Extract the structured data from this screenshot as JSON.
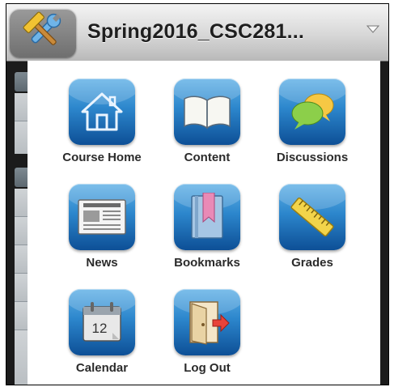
{
  "header": {
    "course_title": "Spring2016_CSC281...",
    "tools_icon": "tools-icon",
    "dropdown_icon": "chevron-down-icon"
  },
  "menu": {
    "items": [
      {
        "label": "Course Home",
        "icon": "home-icon"
      },
      {
        "label": "Content",
        "icon": "book-icon"
      },
      {
        "label": "Discussions",
        "icon": "speech-bubbles-icon"
      },
      {
        "label": "News",
        "icon": "newspaper-icon"
      },
      {
        "label": "Bookmarks",
        "icon": "bookmark-icon"
      },
      {
        "label": "Grades",
        "icon": "ruler-icon"
      },
      {
        "label": "Calendar",
        "icon": "calendar-icon"
      },
      {
        "label": "Log Out",
        "icon": "logout-door-icon"
      }
    ],
    "calendar_day": "12"
  },
  "colors": {
    "tile_top": "#5fb0e6",
    "tile_bottom": "#0d4f96",
    "label_text": "#2b2b2b"
  }
}
